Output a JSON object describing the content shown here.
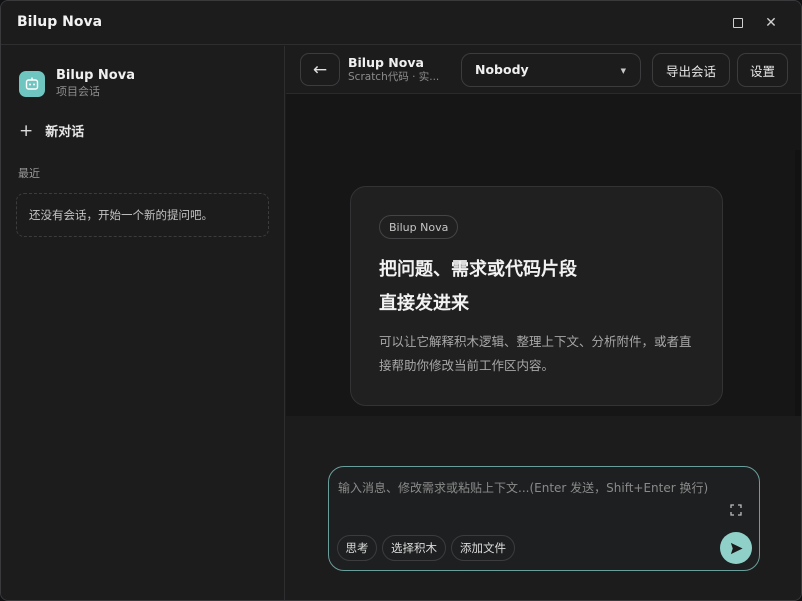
{
  "app": {
    "title": "Bilup Nova"
  },
  "sidebar": {
    "project_name": "Bilup Nova",
    "project_sub": "项目会话",
    "new_chat_label": "新对话",
    "recent_label": "最近",
    "empty_text": "还没有会话，开始一个新的提问吧。"
  },
  "topbar": {
    "back_glyph": "←",
    "conversation_name": "Bilup Nova",
    "conversation_sub": "Scratch代码 · 实...",
    "model_selected": "Nobody",
    "export_label": "导出会话",
    "settings_label": "设置"
  },
  "welcome": {
    "badge": "Bilup Nova",
    "heading_line1": "把问题、需求或代码片段",
    "heading_line2": "直接发进来",
    "description": "可以让它解释积木逻辑、整理上下文、分析附件，或者直接帮助你修改当前工作区内容。"
  },
  "composer": {
    "placeholder": "输入消息、修改需求或粘贴上下文...(Enter 发送，Shift+Enter 换行)",
    "think_label": "思考",
    "select_blocks_label": "选择积木",
    "add_file_label": "添加文件"
  },
  "colors": {
    "accent": "#8fd0c8",
    "accent_border": "#6a9e9a",
    "project_icon_bg": "#6fc6c0"
  },
  "icons": {
    "project": "bot-icon",
    "maximize": "maximize-icon",
    "close": "close-icon",
    "back": "arrow-left-icon",
    "caret": "chevron-down-icon",
    "expand": "expand-icon",
    "send": "send-icon"
  }
}
